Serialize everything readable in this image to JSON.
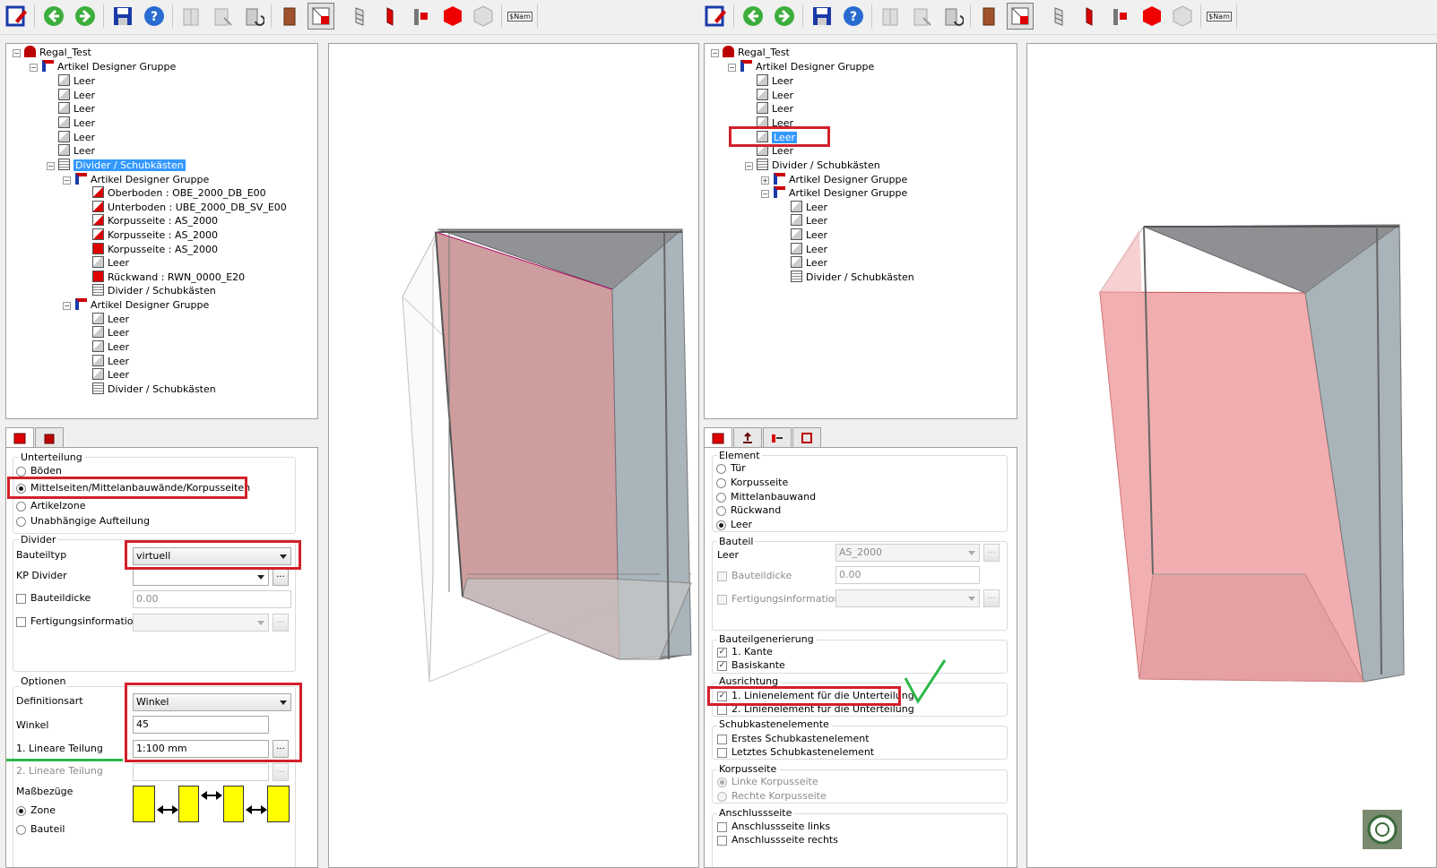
{
  "left": {
    "tree": {
      "root": "Regal_Test",
      "group": "Artikel Designer Gruppe",
      "leer": [
        "Leer",
        "Leer",
        "Leer",
        "Leer",
        "Leer",
        "Leer"
      ],
      "divider": "Divider / Schubkästen",
      "sub1": {
        "title": "Artikel Designer Gruppe",
        "items": [
          "Oberboden : OBE_2000_DB_E00",
          "Unterboden : UBE_2000_DB_SV_E00",
          "Korpusseite : AS_2000",
          "Korpusseite : AS_2000",
          "Korpusseite : AS_2000",
          "Leer",
          "Rückwand : RWN_0000_E20",
          "Divider / Schubkästen"
        ]
      },
      "sub2": {
        "title": "Artikel Designer Gruppe",
        "items": [
          "Leer",
          "Leer",
          "Leer",
          "Leer",
          "Leer",
          "Divider / Schubkästen"
        ]
      }
    },
    "props": {
      "unterteilung": {
        "title": "Unterteilung",
        "options": [
          "Böden",
          "Mittelseiten/Mittelanbauwände/Korpusseiten",
          "Artikelzone",
          "Unabhängige Aufteilung"
        ],
        "selected": 1
      },
      "divider": {
        "title": "Divider",
        "bauteiltyp_label": "Bauteiltyp",
        "bauteiltyp_value": "virtuell",
        "kp_label": "KP Divider",
        "kp_value": "",
        "ellipsis": "...",
        "dicke_label": "Bauteildicke",
        "dicke_value": "0.00",
        "fert_label": "Fertigungsinformation",
        "fert_value": ""
      },
      "optionen": {
        "title": "Optionen",
        "defart_label": "Definitionsart",
        "defart_value": "Winkel",
        "winkel_label": "Winkel",
        "winkel_value": "45",
        "lin1_label": "1. Lineare Teilung",
        "lin1_value": "1:100 mm",
        "lin2_label": "2. Lineare Teilung",
        "lin2_value": "",
        "mass_label": "Maßbezüge",
        "mass_options": [
          "Zone",
          "Bauteil"
        ],
        "mass_selected": 0
      }
    }
  },
  "right": {
    "tree": {
      "root": "Regal_Test",
      "group": "Artikel Designer Gruppe",
      "leer": [
        "Leer",
        "Leer",
        "Leer",
        "Leer",
        "Leer",
        "Leer"
      ],
      "divider": "Divider / Schubkästen",
      "subA": "Artikel Designer Gruppe",
      "subB": "Artikel Designer Gruppe",
      "subB_items": [
        "Leer",
        "Leer",
        "Leer",
        "Leer",
        "Leer",
        "Divider / Schubkästen"
      ]
    },
    "props": {
      "element": {
        "title": "Element",
        "options": [
          "Tür",
          "Korpusseite",
          "Mittelanbauwand",
          "Rückwand",
          "Leer"
        ],
        "selected": 4
      },
      "bauteil": {
        "title": "Bauteil",
        "leer_label": "Leer",
        "combo_value": "AS_2000",
        "ellipsis": "...",
        "dicke_label": "Bauteildicke",
        "dicke_value": "0.00",
        "fert_label": "Fertigungsinformation",
        "fert_value": ""
      },
      "generierung": {
        "title": "Bauteilgenerierung",
        "items": [
          "1. Kante",
          "Basiskante"
        ]
      },
      "ausrichtung": {
        "title": "Ausrichtung",
        "items": [
          "1. Linienelement für die Unterteilung",
          "2. Linienelement für die Unterteilung"
        ]
      },
      "schub": {
        "title": "Schubkastenelemente",
        "items": [
          "Erstes Schubkastenelement",
          "Letztes Schubkastenelement"
        ]
      },
      "korpus": {
        "title": "Korpusseite",
        "items": [
          "Linke Korpusseite",
          "Rechte Korpusseite"
        ]
      },
      "anschluss": {
        "title": "Anschlussseite",
        "items": [
          "Anschlussseite links",
          "Anschlussseite rechts"
        ]
      }
    }
  },
  "colors": {
    "highlight": "#d3202a",
    "checkmark": "#2db84a",
    "selection": "#3399ff",
    "underline": "#2db84a"
  },
  "toolbar": {
    "name_button": "$Nam"
  }
}
